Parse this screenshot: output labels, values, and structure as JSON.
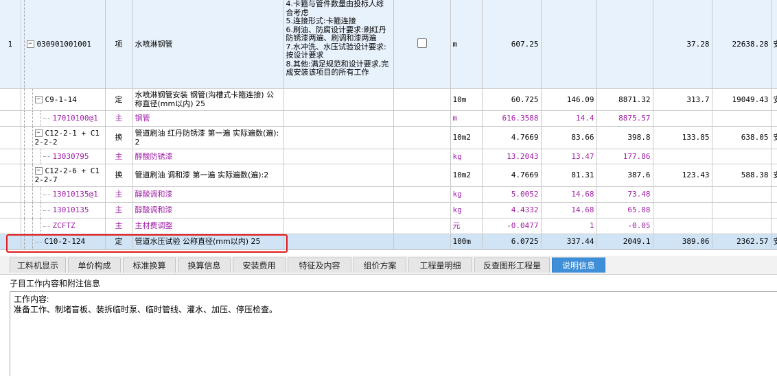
{
  "rows": [
    {
      "idx": "1",
      "code": "030901001001",
      "type": "项",
      "name": "水喷淋钢管",
      "feature": "4.卡箍与管件数量由投标人综合考虑\n5.连接形式:卡箍连接\n6.刷油、防腐设计要求:刷红丹防锈漆两遍、刷调和漆两遍\n7.水冲洗、水压试验设计要求:按设计要求\n8.其他:满足规范和设计要求,完成安装该项目的所有工作",
      "unit": "m",
      "qty": "607.25",
      "price": "",
      "amount": "",
      "c1": "37.28",
      "c2": "22638.28",
      "tail": "安"
    },
    {
      "idx": "",
      "code": "C9-1-14",
      "type": "定",
      "name": "水喷淋钢管安装 钢管(沟槽式卡箍连接) 公称直径(mm以内) 25",
      "feature": "",
      "unit": "10m",
      "qty": "60.725",
      "price": "146.09",
      "amount": "8871.32",
      "c1": "313.7",
      "c2": "19049.43",
      "tail": "安"
    },
    {
      "idx": "",
      "code": "17010100@1",
      "type": "主",
      "name": "钢管",
      "feature": "",
      "unit": "m",
      "qty": "616.3588",
      "price": "14.4",
      "amount": "8875.57",
      "c1": "",
      "c2": "",
      "tail": ""
    },
    {
      "idx": "",
      "code": "C12-2-1 + C12-2-2",
      "type": "换",
      "name": "管道刷油 红丹防锈漆 第一遍  实际遍数(遍):2",
      "feature": "",
      "unit": "10m2",
      "qty": "4.7669",
      "price": "83.66",
      "amount": "398.8",
      "c1": "133.85",
      "c2": "638.05",
      "tail": "安"
    },
    {
      "idx": "",
      "code": "13030795",
      "type": "主",
      "name": "醇酸防锈漆",
      "feature": "",
      "unit": "kg",
      "qty": "13.2043",
      "price": "13.47",
      "amount": "177.86",
      "c1": "",
      "c2": "",
      "tail": ""
    },
    {
      "idx": "",
      "code": "C12-2-6 + C12-2-7",
      "type": "换",
      "name": "管道刷油 调和漆 第一遍  实际遍数(遍):2",
      "feature": "",
      "unit": "10m2",
      "qty": "4.7669",
      "price": "81.31",
      "amount": "387.6",
      "c1": "123.43",
      "c2": "588.38",
      "tail": "安"
    },
    {
      "idx": "",
      "code": "13010135@1",
      "type": "主",
      "name": "醇酸调和漆",
      "feature": "",
      "unit": "kg",
      "qty": "5.0052",
      "price": "14.68",
      "amount": "73.48",
      "c1": "",
      "c2": "",
      "tail": ""
    },
    {
      "idx": "",
      "code": "13010135",
      "type": "主",
      "name": "醇酸调和漆",
      "feature": "",
      "unit": "kg",
      "qty": "4.4332",
      "price": "14.68",
      "amount": "65.08",
      "c1": "",
      "c2": "",
      "tail": ""
    },
    {
      "idx": "",
      "code": "ZCFTZ",
      "type": "主",
      "name": "主材费调整",
      "feature": "",
      "unit": "元",
      "qty": "-0.0477",
      "price": "1",
      "amount": "-0.05",
      "c1": "",
      "c2": "",
      "tail": ""
    },
    {
      "idx": "",
      "code": "C10-2-124",
      "type": "定",
      "name": "管道水压试验 公称直径(mm以内) 25",
      "feature": "",
      "unit": "100m",
      "qty": "6.0725",
      "price": "337.44",
      "amount": "2049.1",
      "c1": "389.06",
      "c2": "2362.57",
      "tail": "安"
    }
  ],
  "tabs": [
    "工料机显示",
    "单价构成",
    "标准换算",
    "换算信息",
    "安装费用",
    "特征及内容",
    "组价方案",
    "工程量明细",
    "反查图形工程量",
    "说明信息"
  ],
  "active_tab_index": 9,
  "notes": {
    "label": "子目工作内容和附注信息",
    "text": "工作内容:\n准备工作、制堵盲板、装拆临时泵、临时管线、灌水、加压、停压检查。"
  },
  "colors": {
    "main_material": "#a020a8",
    "active_tab": "#3f8fd8",
    "selection_box": "#e01c1c"
  }
}
